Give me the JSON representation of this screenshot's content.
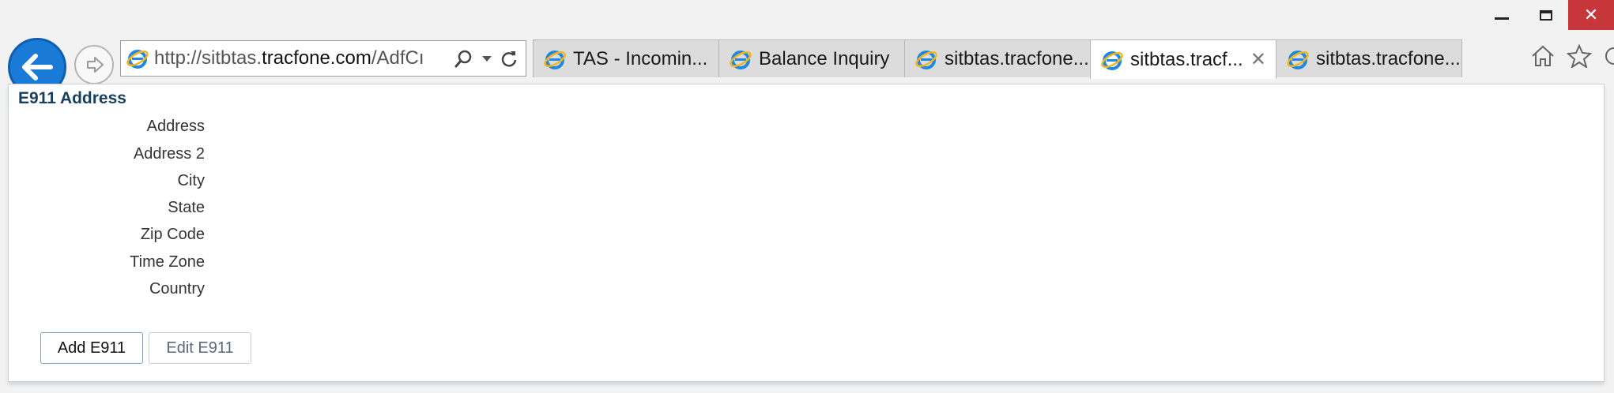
{
  "browser": {
    "url_prefix": "http://sitbtas.",
    "url_host": "tracfone.com",
    "url_suffix": "/AdfCı",
    "tabs": [
      {
        "title": "TAS - Incomin...",
        "active": false
      },
      {
        "title": "Balance Inquiry",
        "active": false
      },
      {
        "title": "sitbtas.tracfone...",
        "active": false
      },
      {
        "title": "sitbtas.tracf...",
        "active": true
      },
      {
        "title": "sitbtas.tracfone...",
        "active": false
      }
    ],
    "close_glyph": "✕",
    "tab_close_glyph": "✕"
  },
  "e911": {
    "title": "E911 Address",
    "fields": {
      "address": "Address",
      "address2": "Address 2",
      "city": "City",
      "state": "State",
      "zip": "Zip Code",
      "timezone": "Time Zone",
      "country": "Country"
    },
    "buttons": {
      "add": "Add E911",
      "edit": "Edit E911"
    }
  },
  "colors": {
    "accent": "#1a7bd6",
    "title": "#1a3f5c",
    "close": "#c7363a"
  }
}
